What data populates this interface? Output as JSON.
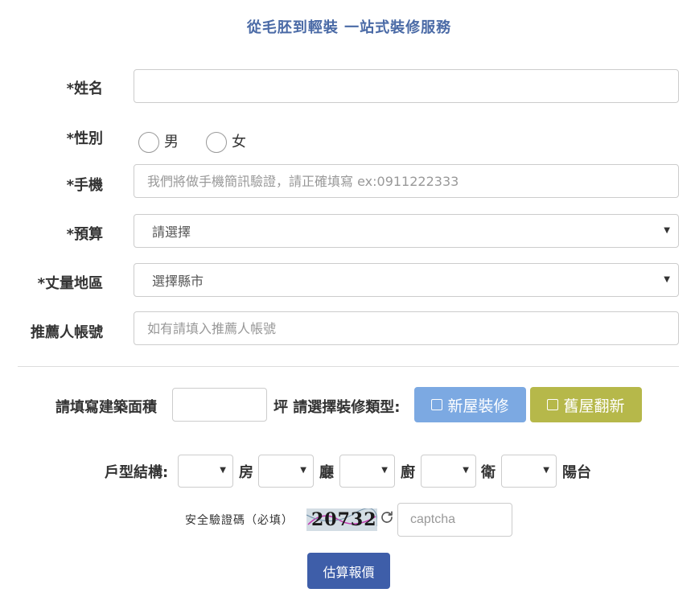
{
  "title": "從毛胚到輕裝 一站式裝修服務",
  "form": {
    "name_label": "*姓名",
    "name_value": "",
    "gender_label": "*性別",
    "gender_male": "男",
    "gender_female": "女",
    "phone_label": "*手機",
    "phone_placeholder": "我們將做手機簡訊驗證，請正確填寫 ex:0911222333",
    "budget_label": "*預算",
    "budget_selected": "請選擇",
    "area_label": "*丈量地區",
    "area_selected": "選擇縣市",
    "referrer_label": "推薦人帳號",
    "referrer_placeholder": "如有請填入推薦人帳號"
  },
  "building": {
    "area_prompt": "請填寫建築面積",
    "unit_prompt": "坪 請選擇裝修類型:",
    "type_new": "新屋裝修",
    "type_old": "舊屋翻新"
  },
  "layout": {
    "label": "戶型結構:",
    "room": "房",
    "living": "廳",
    "kitchen": "廚",
    "bath": "衛",
    "balcony": "陽台"
  },
  "captcha": {
    "label": "安全驗證碼（必填）",
    "code": "20732",
    "placeholder": "captcha"
  },
  "submit_label": "估算報價",
  "colors": {
    "title": "#4a6aa6",
    "new_button": "#7ca9e2",
    "old_button": "#b6b84a",
    "submit_button": "#3e5ea9"
  }
}
